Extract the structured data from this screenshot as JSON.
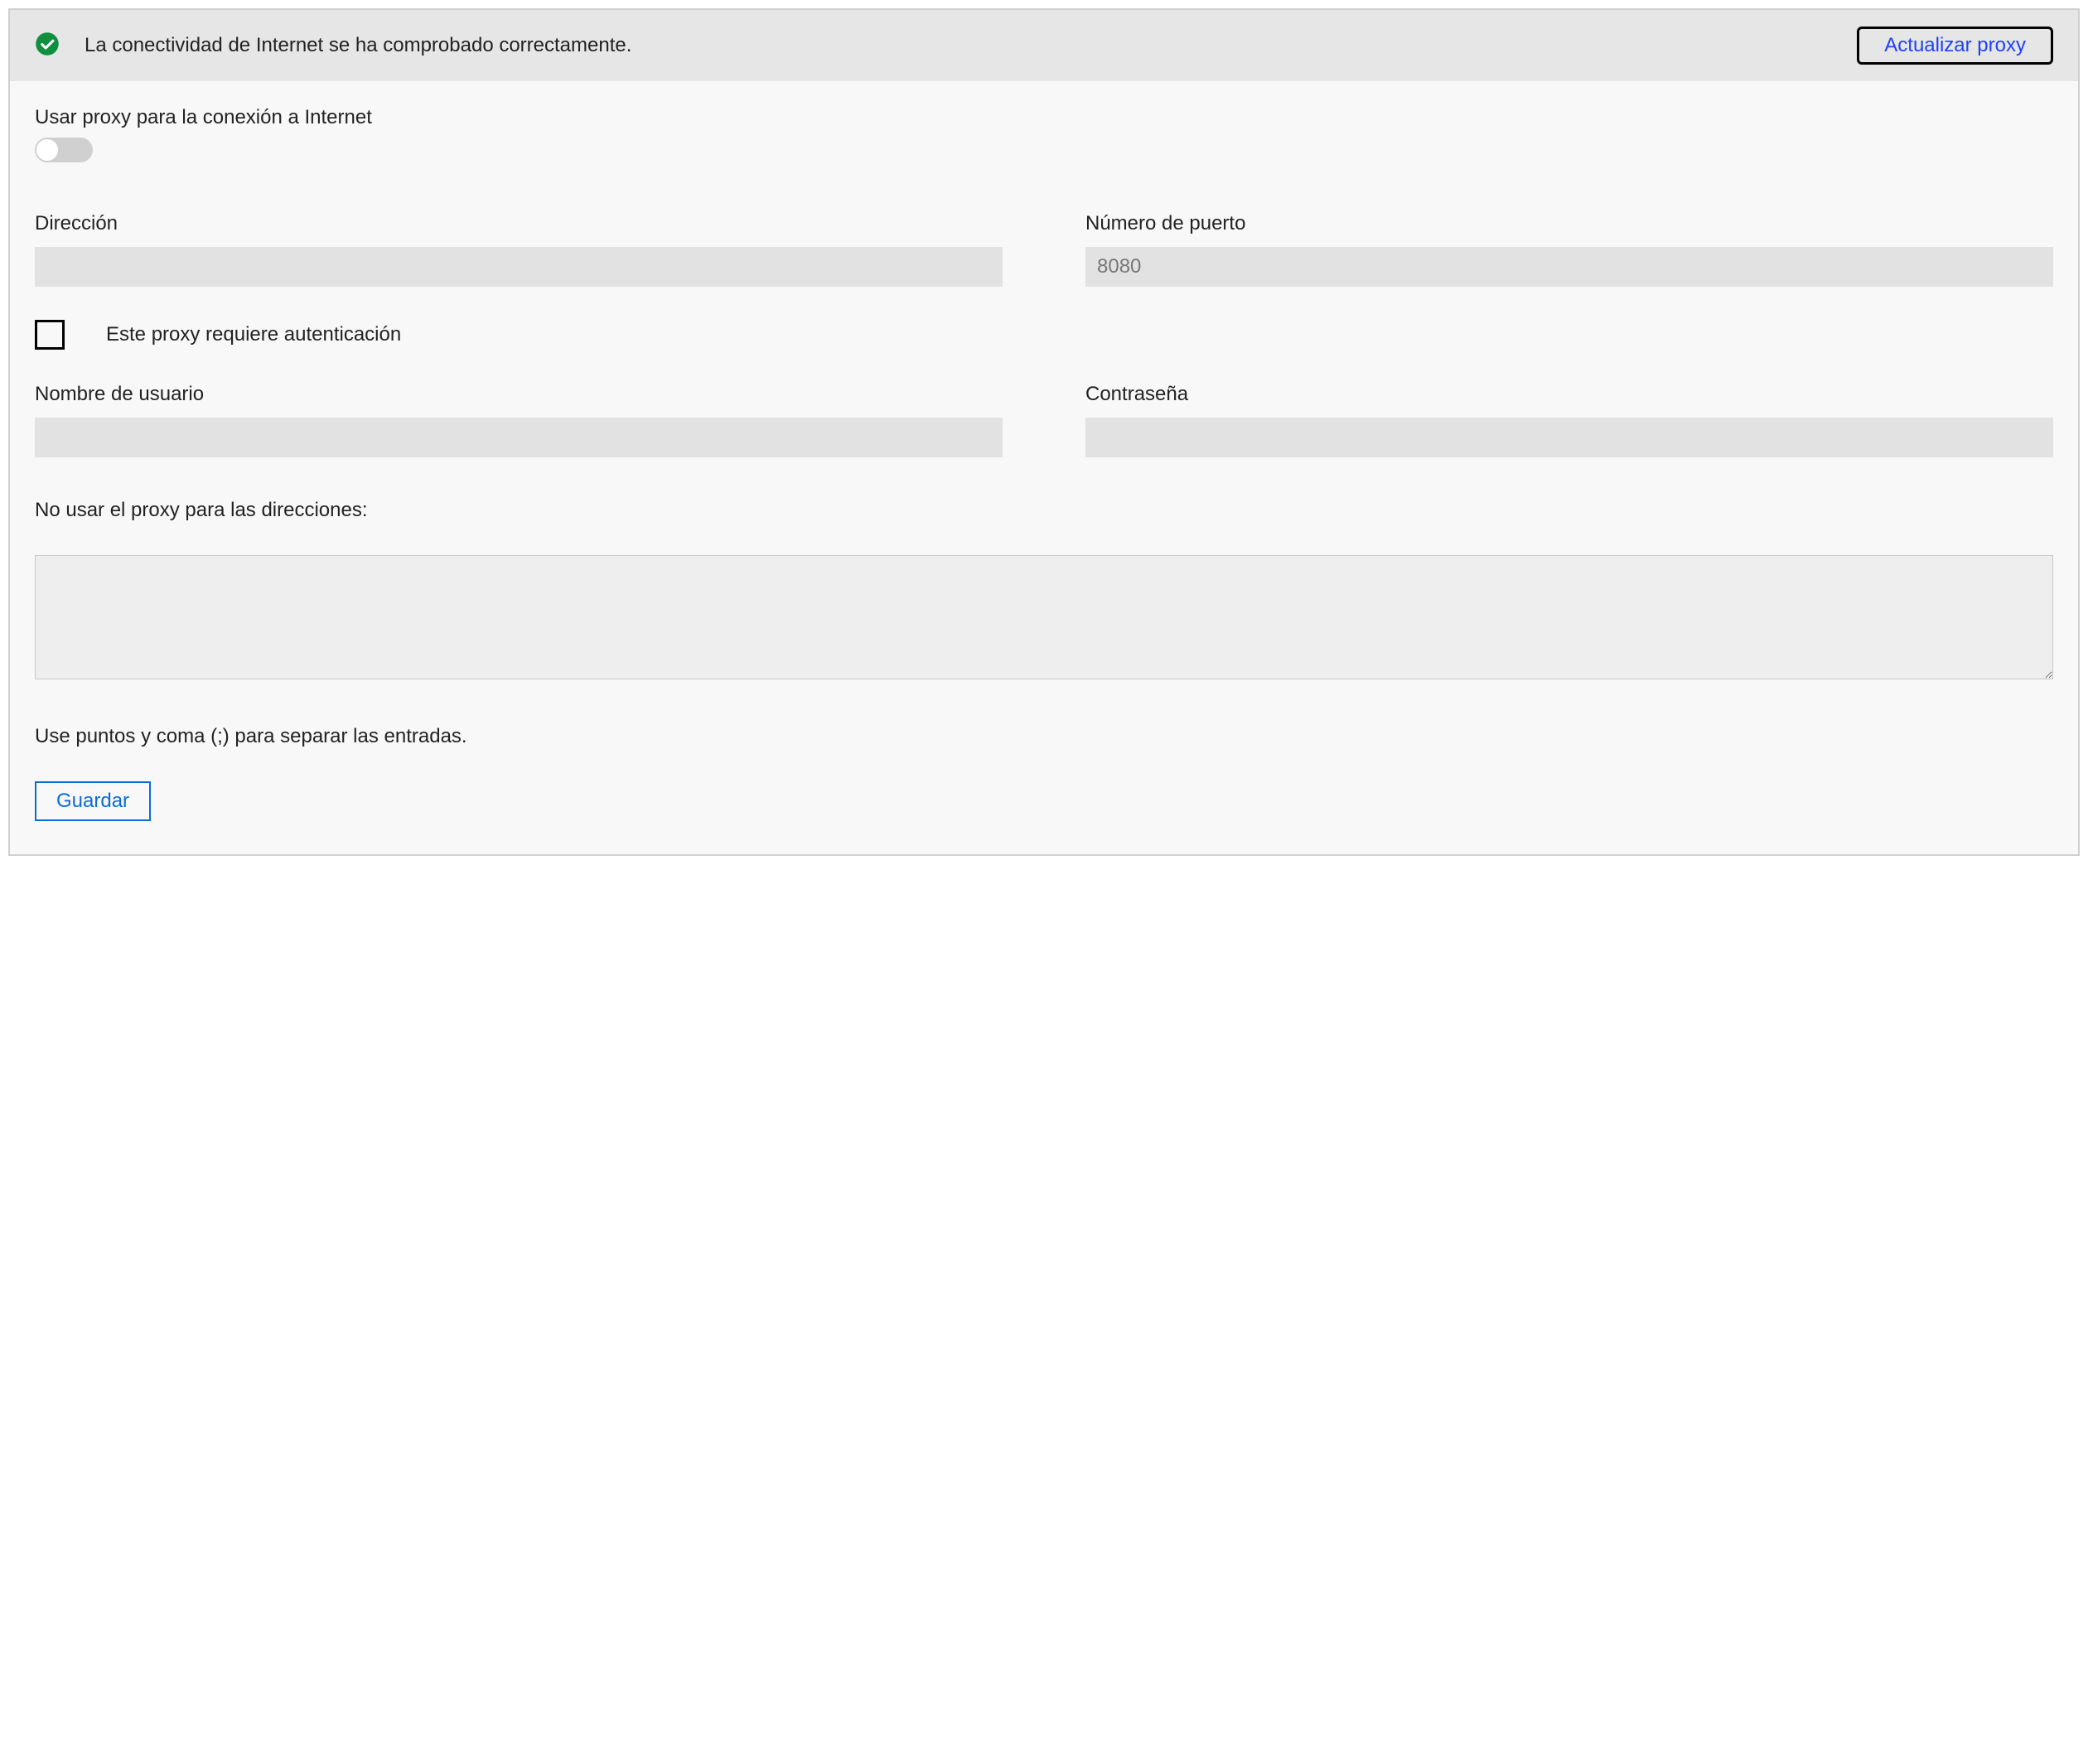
{
  "banner": {
    "message": "La conectividad de Internet se ha comprobado correctamente.",
    "refresh_label": "Actualizar proxy"
  },
  "proxy": {
    "toggle_label": "Usar proxy para la conexión a Internet",
    "toggle_on": false,
    "address_label": "Dirección",
    "address_value": "",
    "port_label": "Número de puerto",
    "port_placeholder": "8080",
    "auth_checkbox_label": "Este proxy requiere autenticación",
    "auth_checked": false,
    "username_label": "Nombre de usuario",
    "username_value": "",
    "password_label": "Contraseña",
    "password_value": "",
    "bypass_label": "No usar el proxy para las direcciones:",
    "bypass_value": "",
    "bypass_hint": "Use puntos y coma (;) para separar las entradas.",
    "save_label": "Guardar"
  }
}
